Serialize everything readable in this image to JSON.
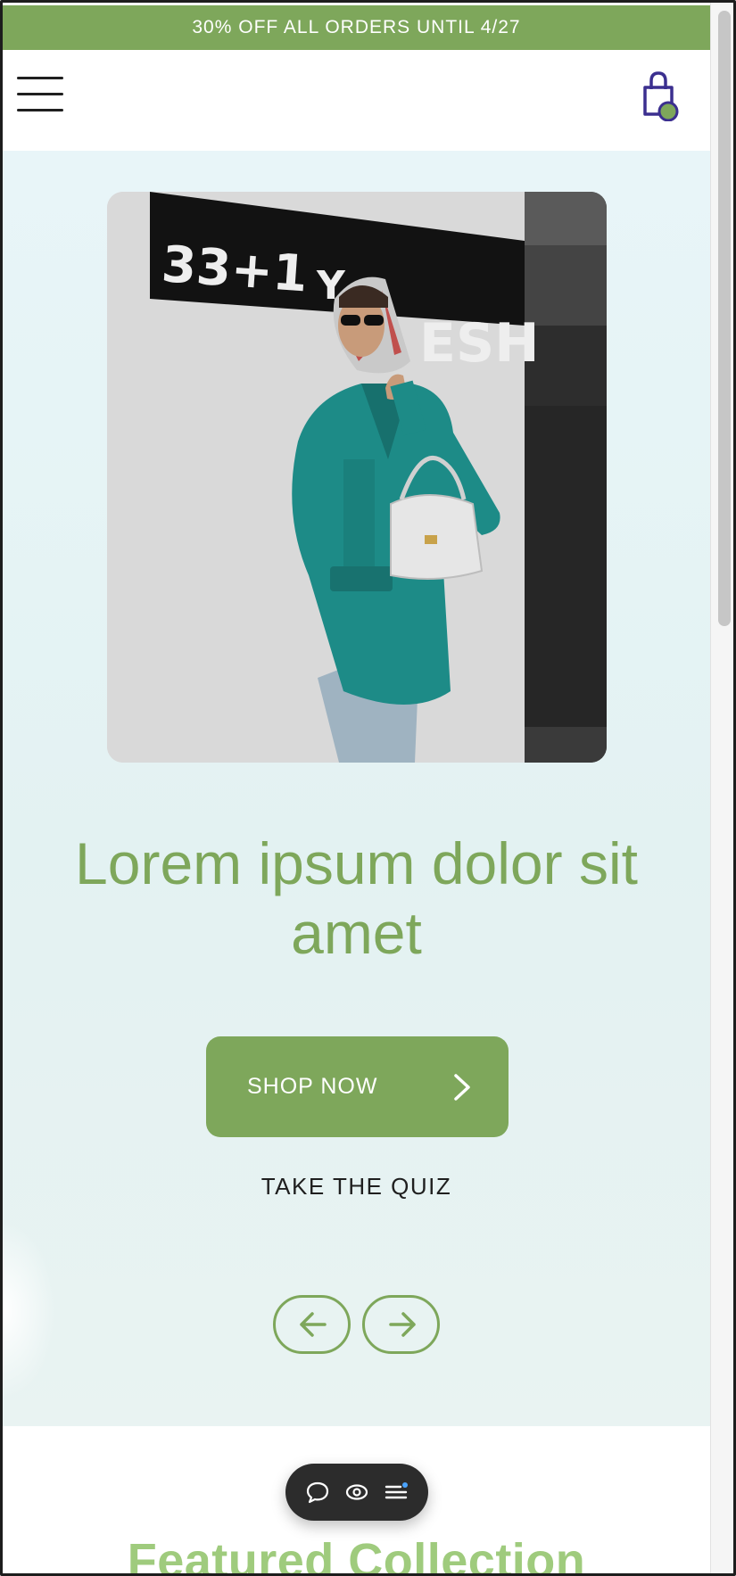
{
  "announcement": {
    "text": "30% OFF ALL ORDERS UNTIL 4/27"
  },
  "header": {
    "menu_icon": "hamburger-menu-icon",
    "cart_icon": "shopping-bag-icon"
  },
  "hero": {
    "image_description_icon": "hero-photo",
    "sign_text": "33+1",
    "title": "Lorem ipsum dolor sit amet",
    "cta_label": "SHOP NOW",
    "secondary_link": "TAKE THE QUIZ",
    "prev_icon": "arrow-left-icon",
    "next_icon": "arrow-right-icon"
  },
  "featured": {
    "title": "Featured Collection"
  },
  "toolbar": {
    "icons": [
      "chat-bubble-icon",
      "eye-icon",
      "list-icon"
    ]
  },
  "colors": {
    "accent": "#7ea75b",
    "accent_light": "#9fcb7d",
    "hero_bg": "#e5f3f4",
    "cart_stroke": "#3b2f8f",
    "text_dark": "#1f1f1f"
  }
}
